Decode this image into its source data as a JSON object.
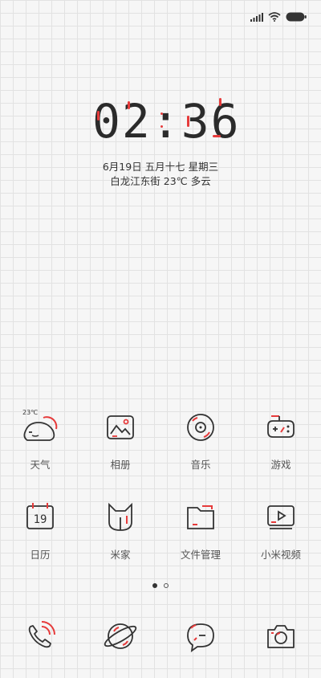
{
  "clock": {
    "time": "02:36"
  },
  "date_line": "6月19日 五月十七  星期三",
  "location_line": "白龙江东街  23℃  多云",
  "status_bar": {
    "signal": "signal-icon",
    "wifi": "wifi-icon",
    "battery": "battery-icon"
  },
  "weather_icon_temp": "23℃",
  "apps_row1": [
    {
      "label": "天气",
      "icon": "weather-icon"
    },
    {
      "label": "相册",
      "icon": "gallery-icon"
    },
    {
      "label": "音乐",
      "icon": "music-icon"
    },
    {
      "label": "游戏",
      "icon": "game-icon"
    }
  ],
  "apps_row2": [
    {
      "label": "日历",
      "icon": "calendar-icon",
      "day": "19"
    },
    {
      "label": "米家",
      "icon": "mijia-icon"
    },
    {
      "label": "文件管理",
      "icon": "folder-icon"
    },
    {
      "label": "小米视频",
      "icon": "video-icon"
    }
  ],
  "dock": [
    {
      "icon": "phone-icon"
    },
    {
      "icon": "browser-icon"
    },
    {
      "icon": "messages-icon"
    },
    {
      "icon": "camera-icon"
    }
  ],
  "colors": {
    "accent": "#e63b3b",
    "line": "#333333",
    "background": "#f6f6f6"
  }
}
